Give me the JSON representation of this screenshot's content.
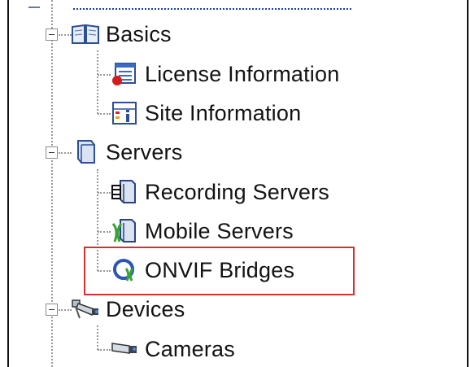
{
  "tree": {
    "basics": {
      "label": "Basics",
      "icon": "open-book-icon",
      "children": [
        {
          "label": "License Information",
          "icon": "license-info-icon"
        },
        {
          "label": "Site Information",
          "icon": "site-info-icon"
        }
      ]
    },
    "servers": {
      "label": "Servers",
      "icon": "server-group-icon",
      "children": [
        {
          "label": "Recording Servers",
          "icon": "recording-server-icon"
        },
        {
          "label": "Mobile Servers",
          "icon": "mobile-server-icon"
        },
        {
          "label": "ONVIF Bridges",
          "icon": "onvif-bridge-icon",
          "highlighted": true
        }
      ]
    },
    "devices": {
      "label": "Devices",
      "icon": "devices-cctv-icon",
      "children": [
        {
          "label": "Cameras",
          "icon": "camera-icon"
        }
      ]
    }
  },
  "colors": {
    "highlight_border": "#d0322e",
    "connector": "#9a9a9a",
    "text": "#121212"
  }
}
